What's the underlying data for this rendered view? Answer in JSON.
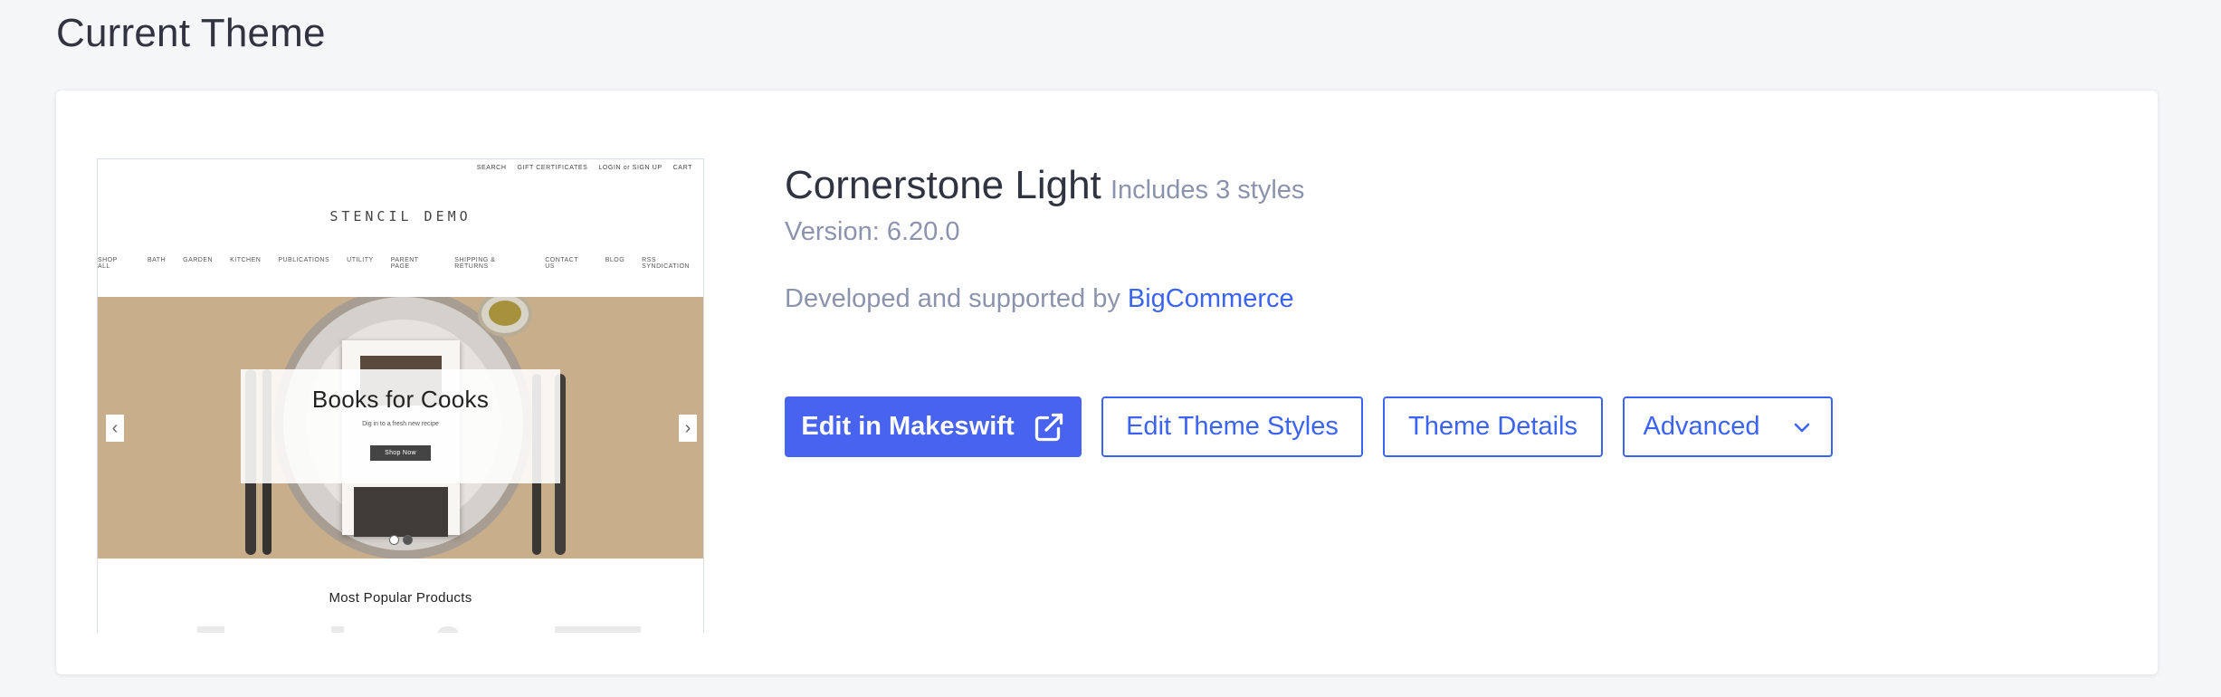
{
  "page": {
    "title": "Current Theme"
  },
  "thumbnail": {
    "utility_links": [
      "SEARCH",
      "GIFT CERTIFICATES",
      "LOGIN or SIGN UP",
      "CART"
    ],
    "store_name": "STENCIL DEMO",
    "nav_items": [
      "SHOP ALL",
      "BATH",
      "GARDEN",
      "KITCHEN",
      "PUBLICATIONS",
      "UTILITY",
      "PARENT PAGE",
      "SHIPPING & RETURNS",
      "CONTACT US",
      "BLOG",
      "RSS SYNDICATION"
    ],
    "hero": {
      "heading": "Books for Cooks",
      "subtext": "Dig in to a fresh new recipe",
      "button": "Shop Now",
      "prev_arrow": "‹",
      "next_arrow": "›",
      "slide_count": 2,
      "active_slide": 2
    },
    "section_heading": "Most Popular Products"
  },
  "theme": {
    "name": "Cornerstone Light",
    "styles_note": "Includes 3 styles",
    "version": "Version: 6.20.0",
    "developer_prefix": "Developed and supported by",
    "developer_name": "BigCommerce"
  },
  "actions": {
    "edit_makeswift": "Edit in Makeswift",
    "edit_makeswift_icon": "external-link-icon",
    "edit_styles": "Edit Theme Styles",
    "details": "Theme Details",
    "advanced": "Advanced",
    "advanced_icon": "chevron-down-icon"
  },
  "colors": {
    "background": "#f5f6f8",
    "card": "#ffffff",
    "primary": "#4763ef",
    "link": "#3c64f4",
    "muted_text": "#8c93ad",
    "text": "#313440"
  }
}
